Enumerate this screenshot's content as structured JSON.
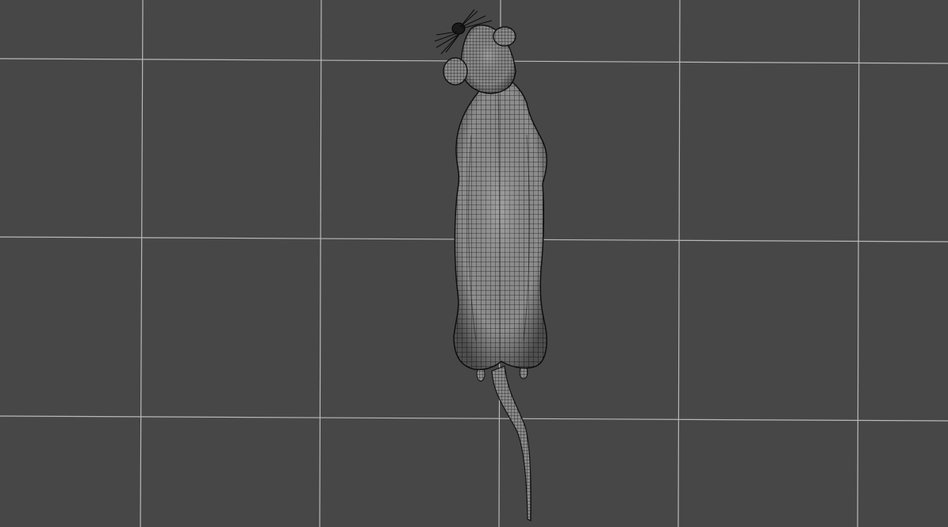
{
  "viewport": {
    "background_color": "#474747",
    "grid_color": "#b9b9b9",
    "mesh_fill_color": "#8a8a8a",
    "wire_color": "#1a1a1a"
  },
  "scene": {
    "object": "rat-wireframe-mesh",
    "view": "top-down"
  }
}
